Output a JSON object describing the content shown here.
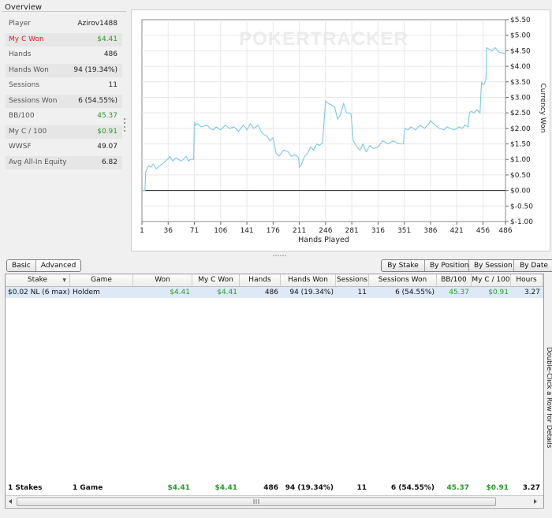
{
  "overview": {
    "title": "Overview",
    "rows": [
      {
        "label": "Player",
        "value": "Azirov1488"
      },
      {
        "label": "My C Won",
        "value": "$4.41"
      },
      {
        "label": "Hands",
        "value": "486"
      },
      {
        "label": "Hands Won",
        "value": "94 (19.34%)"
      },
      {
        "label": "Sessions",
        "value": "11"
      },
      {
        "label": "Sessions Won",
        "value": "6 (54.55%)"
      },
      {
        "label": "BB/100",
        "value": "45.37"
      },
      {
        "label": "My C / 100",
        "value": "$0.91"
      },
      {
        "label": "WWSF",
        "value": "49.07"
      },
      {
        "label": "Avg All-In Equity",
        "value": "6.82"
      }
    ]
  },
  "chart_data": {
    "type": "line",
    "watermark": "POKERTRACKER",
    "xlabel": "Hands Played",
    "ylabel": "Currency Won",
    "xlim": [
      1,
      486
    ],
    "ylim": [
      -1.0,
      5.5
    ],
    "x_ticks": [
      "1",
      "36",
      "71",
      "106",
      "141",
      "176",
      "211",
      "246",
      "281",
      "316",
      "351",
      "386",
      "421",
      "456",
      "486"
    ],
    "y_ticks": [
      "$5.50",
      "$5.00",
      "$4.50",
      "$4.00",
      "$3.50",
      "$3.00",
      "$2.50",
      "$2.00",
      "$1.50",
      "$1.00",
      "$0.50",
      "$0.00",
      "$-0.50",
      "$-1.00"
    ],
    "grid": true,
    "series": [
      {
        "x": [
          1,
          5,
          6,
          8,
          10,
          13,
          16,
          20,
          25,
          30,
          35,
          38,
          42,
          46,
          50,
          53,
          56,
          60,
          63,
          66,
          70,
          71,
          72,
          75,
          80,
          88,
          92,
          96,
          100,
          106,
          112,
          118,
          124,
          130,
          136,
          140,
          141,
          146,
          150,
          156,
          160,
          164,
          168,
          172,
          176,
          180,
          184,
          190,
          196,
          200,
          206,
          210,
          211,
          213,
          218,
          222,
          226,
          230,
          234,
          238,
          242,
          246,
          247,
          250,
          254,
          258,
          262,
          266,
          270,
          274,
          278,
          280,
          283,
          288,
          292,
          296,
          300,
          305,
          310,
          316,
          322,
          326,
          330,
          336,
          340,
          345,
          350,
          351,
          352,
          356,
          360,
          366,
          372,
          378,
          384,
          386,
          392,
          398,
          404,
          408,
          412,
          418,
          424,
          428,
          432,
          436,
          438,
          440,
          444,
          448,
          452,
          454,
          456,
          458,
          460,
          461,
          464,
          468,
          472,
          478,
          486
        ],
        "y": [
          0,
          0,
          0.6,
          0.7,
          0.8,
          0.75,
          0.85,
          0.7,
          0.8,
          0.9,
          1.0,
          1.1,
          0.95,
          1.05,
          1.0,
          0.95,
          1.0,
          1.1,
          0.95,
          1.0,
          1.0,
          2.2,
          2.1,
          2.15,
          2.05,
          2.1,
          2.0,
          1.95,
          2.05,
          1.95,
          2.1,
          2.0,
          2.05,
          1.9,
          2.1,
          2.0,
          1.95,
          2.15,
          2.0,
          2.1,
          1.9,
          1.8,
          1.75,
          1.6,
          1.7,
          1.2,
          1.1,
          1.3,
          1.25,
          1.1,
          1.15,
          1.05,
          0.75,
          0.8,
          1.1,
          1.2,
          1.4,
          1.3,
          1.5,
          1.45,
          1.55,
          2.9,
          2.85,
          2.8,
          2.75,
          2.7,
          2.3,
          2.45,
          2.8,
          2.5,
          2.5,
          2.45,
          1.6,
          1.4,
          1.3,
          1.5,
          1.25,
          1.45,
          1.35,
          1.4,
          1.6,
          1.55,
          1.5,
          1.6,
          1.55,
          1.5,
          1.5,
          1.9,
          2.0,
          1.95,
          2.05,
          1.95,
          2.1,
          2.0,
          2.15,
          2.25,
          2.1,
          2.0,
          1.95,
          2.05,
          2.0,
          1.95,
          2.05,
          2.0,
          2.1,
          2.05,
          2.5,
          2.55,
          2.5,
          2.6,
          2.5,
          3.5,
          3.4,
          3.45,
          3.6,
          4.6,
          4.55,
          4.5,
          4.6,
          4.45,
          4.41
        ]
      }
    ]
  },
  "view_toggle": [
    "Basic",
    "Advanced"
  ],
  "group_toggle": [
    "By Stake",
    "By Position",
    "By Session",
    "By Date"
  ],
  "table": {
    "columns": [
      "Stake",
      "Game",
      "Won",
      "My C Won",
      "Hands",
      "Hands Won",
      "Sessions",
      "Sessions Won",
      "BB/100",
      "My C / 100",
      "Hours"
    ],
    "sort_indicator": "▼",
    "rows": [
      [
        "$0.02 NL (6 max)",
        "Holdem",
        "$4.41",
        "$4.41",
        "486",
        "94 (19.34%)",
        "11",
        "6 (54.55%)",
        "45.37",
        "$0.91",
        "3.27"
      ]
    ],
    "footer": [
      "1 Stakes",
      "1 Game",
      "$4.41",
      "$4.41",
      "486",
      "94 (19.34%)",
      "11",
      "6 (54.55%)",
      "45.37",
      "$0.91",
      "3.27"
    ],
    "side_hint": "Double-Click a Row for Details"
  },
  "colors": {
    "line": "#7cc7ea",
    "green": "#2a9a2a",
    "red": "#e21b1b",
    "selection": "#dde9f7"
  }
}
